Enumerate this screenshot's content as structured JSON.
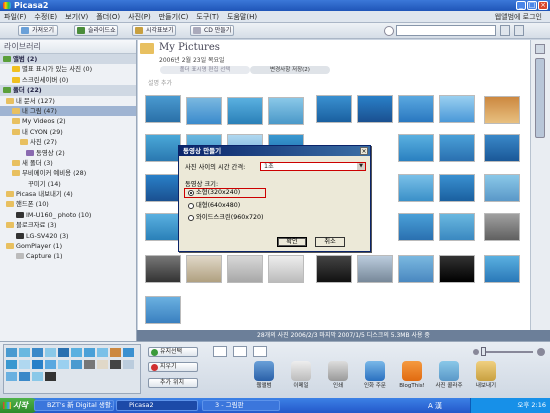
{
  "window": {
    "title": "Picasa2",
    "controls": [
      "_",
      "□",
      "×"
    ]
  },
  "menu": {
    "items": [
      "파일(F)",
      "수정(E)",
      "보기(V)",
      "폴더(O)",
      "사진(P)",
      "만들기(C)",
      "도구(T)",
      "도움말(H)"
    ],
    "right": "웹앨범에 로그인"
  },
  "toolbar": {
    "buttons": [
      "가져오기",
      "슬라이드쇼",
      "시각표보기",
      "CD 만들기"
    ]
  },
  "sidebar": {
    "title": "라이브러리",
    "items": [
      {
        "label": "앨범 (2)",
        "type": "group"
      },
      {
        "label": "별표 표시가 있는 사진 (0)",
        "type": "item"
      },
      {
        "label": "스크린세이버 (0)",
        "type": "item"
      },
      {
        "label": "폴더 (22)",
        "type": "group"
      },
      {
        "label": "내 문서 (127)",
        "type": "item"
      },
      {
        "label": "내 그림 (47)",
        "type": "selected"
      },
      {
        "label": "My Videos (2)",
        "type": "item"
      },
      {
        "label": "내 CYON (29)",
        "type": "item"
      },
      {
        "label": "사진 (27)",
        "type": "item"
      },
      {
        "label": "동영상 (2)",
        "type": "item"
      },
      {
        "label": "새 폴더 (3)",
        "type": "item"
      },
      {
        "label": "무비메이커 예비용 (28)",
        "type": "item"
      },
      {
        "label": "꾸미기 (14)",
        "type": "item"
      },
      {
        "label": "Picasa 내보내기 (4)",
        "type": "item"
      },
      {
        "label": "핸드폰 (10)",
        "type": "item"
      },
      {
        "label": "IM-U160_ photo (10)",
        "type": "item"
      },
      {
        "label": "블로크자료 (3)",
        "type": "item"
      },
      {
        "label": "LG-SV420 (3)",
        "type": "item"
      },
      {
        "label": "GomPlayer (1)",
        "type": "item"
      },
      {
        "label": "Capture (1)",
        "type": "item"
      }
    ]
  },
  "folder": {
    "name": "My Pictures",
    "date": "2006년 2월 23일 목요일",
    "add_description": "설명 추가",
    "pill_left": "폴더 표시명 편집 선택",
    "pill_right": "변경사항 저장(2)"
  },
  "status": {
    "text": "28개의 사진   2006/2/3    마지막 2007/1/5    디스크의 5.3MB 사용 중",
    "count": "28개의 사진",
    "date1": "2006 / 2 / 3",
    "date2": "2007 / 1 / 5",
    "size": "5.3MB"
  },
  "dialog": {
    "title": "동영상 만들기",
    "delay_label": "사진 사이의 시간 간격:",
    "delay_value": "1초",
    "size_label": "동영상 크기:",
    "options": [
      "소형(320x240)",
      "대형(640x480)",
      "와이드스크린(960x720)"
    ],
    "ok": "확인",
    "cancel": "취소"
  },
  "tray": {
    "hold": "유지선택",
    "clear": "지우기",
    "add": "추가 위치"
  },
  "actions": [
    "웹앨범",
    "이메일",
    "인쇄",
    "인화 주문",
    "BlogThis!",
    "사진 콜라주",
    "내보내기"
  ],
  "taskbar": {
    "start": "시작",
    "tasks": [
      "BZT's 新 Digital 생활...",
      "Picasa2",
      "3 - 그림판"
    ],
    "clock": "오후 2:16",
    "ime": "A 漢"
  },
  "colors": {
    "accent": "#3b78d8",
    "highlight": "#cc0000",
    "dialog_title": "#0a246a"
  }
}
